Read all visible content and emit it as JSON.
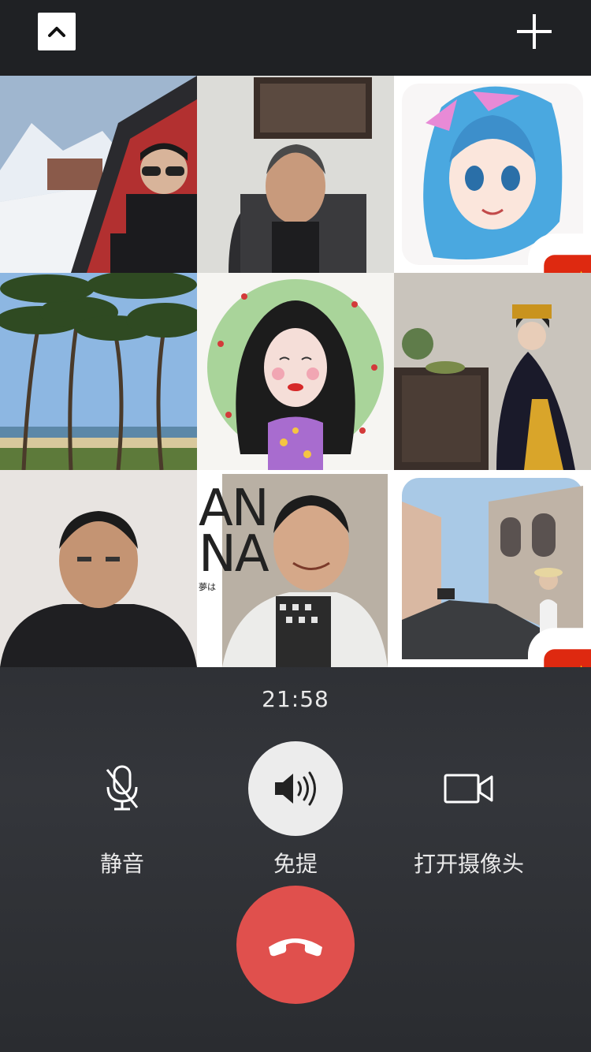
{
  "top_bar": {
    "collapse_icon": "chevron-up-icon",
    "add_icon": "plus-icon"
  },
  "participants": [
    {
      "avatar": "man-on-train-snowy-mountains"
    },
    {
      "avatar": "older-man-in-office-chair"
    },
    {
      "avatar": "anime-girl-blue-hair",
      "badge": "china-flag"
    },
    {
      "avatar": "palm-trees-beach"
    },
    {
      "avatar": "cartoon-girl-curly-hair"
    },
    {
      "avatar": "woman-in-qing-costume"
    },
    {
      "avatar": "man-portrait-dark-jacket"
    },
    {
      "avatar": "man-smiling-white-jacket"
    },
    {
      "avatar": "woman-on-old-town-street",
      "badge": "china-flag"
    }
  ],
  "poster_text": {
    "line1": "AN",
    "line2": "NA",
    "small": "夢は"
  },
  "call": {
    "timer": "21:58"
  },
  "controls": {
    "mute": {
      "label": "静音",
      "icon": "microphone-icon"
    },
    "speaker": {
      "label": "免提",
      "icon": "speaker-icon"
    },
    "camera": {
      "label": "打开摄像头",
      "icon": "video-camera-icon"
    },
    "hangup": {
      "icon": "phone-hangup-icon",
      "color": "#e0504d"
    }
  }
}
